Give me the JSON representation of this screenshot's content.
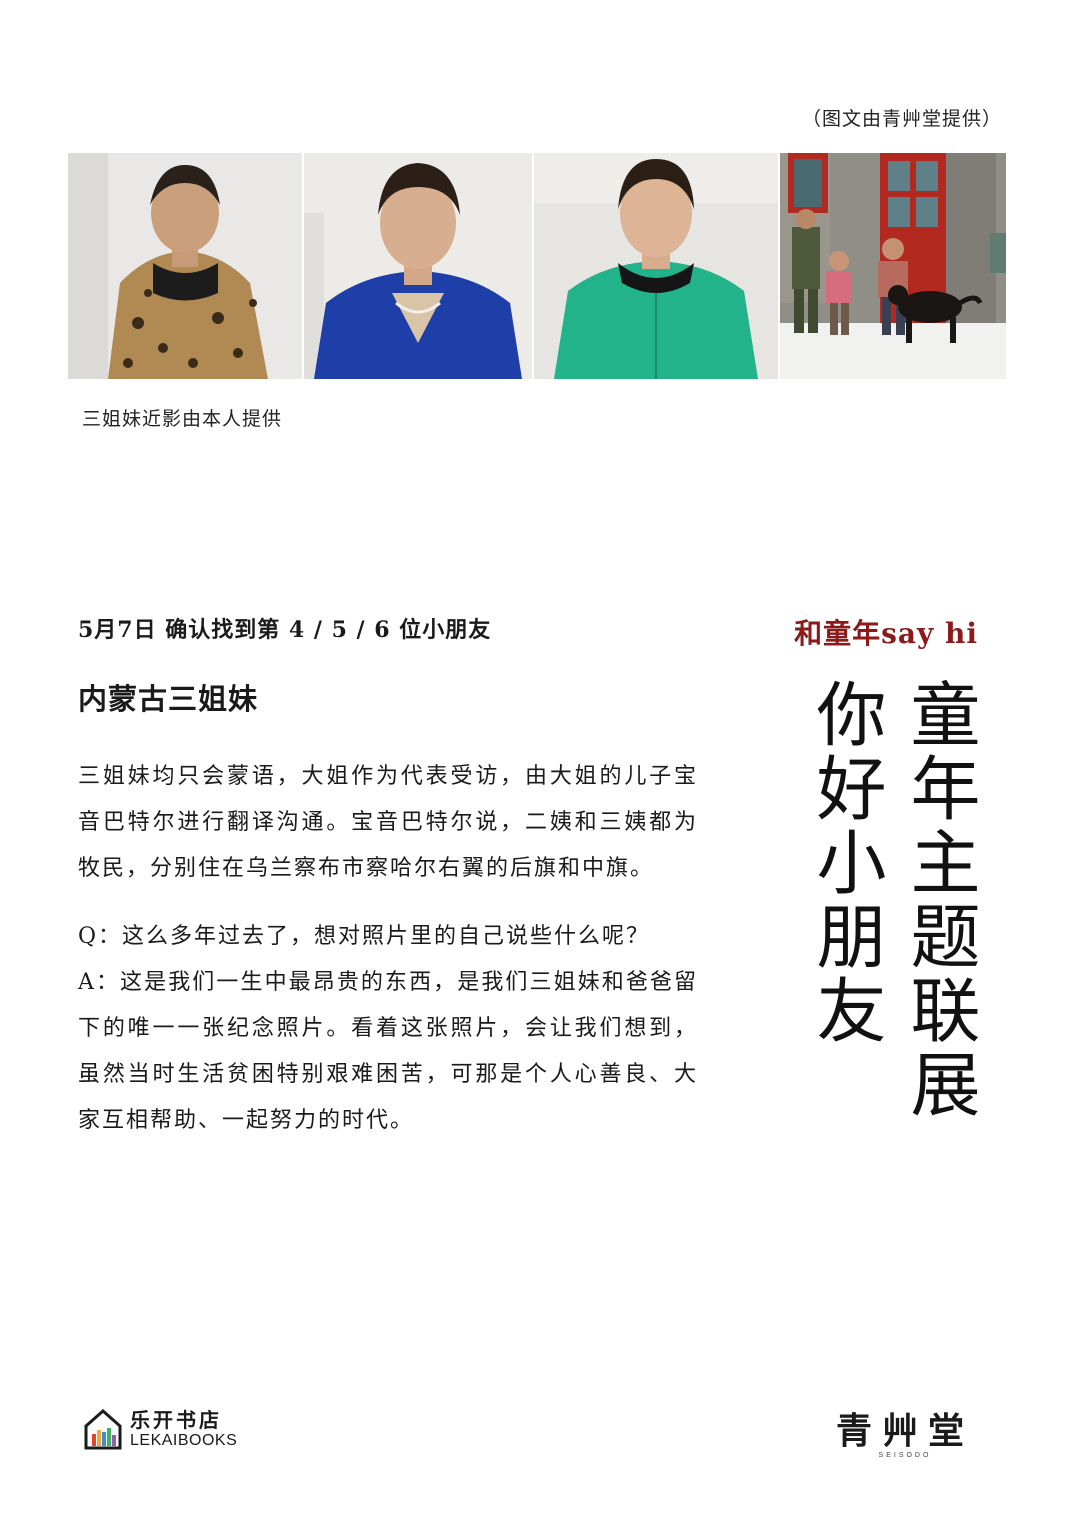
{
  "credit": "（图文由青艸堂提供）",
  "photo_caption": "三姐妹近影由本人提供",
  "header": {
    "date_line": "5月7日 确认找到第 4 / 5 / 6 位小朋友",
    "subtitle": "内蒙古三姐妹"
  },
  "body": {
    "para1": "三姐妹均只会蒙语，大姐作为代表受访，由大姐的儿子宝音巴特尔进行翻译沟通。宝音巴特尔说，二姨和三姨都为牧民，分别住在乌兰察布市察哈尔右翼的后旗和中旗。",
    "question": "Q：这么多年过去了，想对照片里的自己说些什么呢？",
    "answer": "A：这是我们一生中最昂贵的东西，是我们三姐妹和爸爸留下的唯一一张纪念照片。看着这张照片，会让我们想到，虽然当时生活贫困特别艰难困苦，可那是个人心善良、大家互相帮助、一起努力的时代。"
  },
  "side": {
    "tag": "和童年say hi",
    "title_right": "童年主题联展",
    "title_left": "你好小朋友"
  },
  "logos": {
    "left_cn": "乐开书店",
    "left_en": "LEKAIBOOKS",
    "right_cn": "青艸堂",
    "right_en": "SEISODO"
  },
  "colors": {
    "accent_red": "#8b1a1a",
    "text": "#1a1a1a"
  }
}
